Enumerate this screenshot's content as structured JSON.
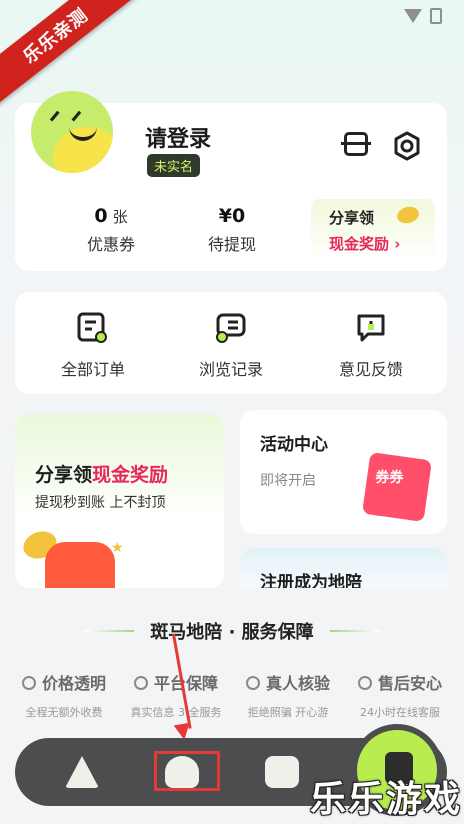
{
  "overlay": {
    "ribbon_text": "乐乐亲测",
    "watermark_text": "乐乐游戏"
  },
  "profile": {
    "login_text": "请登录",
    "verify_badge": "未实名",
    "stats": [
      {
        "num": "0",
        "unit": "张",
        "label": "优惠券"
      },
      {
        "num": "¥0",
        "unit": "",
        "label": "待提现"
      }
    ],
    "share": {
      "line1": "分享领",
      "line2": "现金奖励 ›"
    }
  },
  "orders": [
    {
      "label": "全部订单",
      "icon": "order-list-icon"
    },
    {
      "label": "浏览记录",
      "icon": "history-icon"
    },
    {
      "label": "意见反馈",
      "icon": "feedback-icon"
    }
  ],
  "promo": {
    "share_title_a": "分享领",
    "share_title_b": "现金奖励",
    "share_sub": "提现秒到账 上不封顶",
    "activity_title": "活动中心",
    "activity_sub": "即将开启",
    "coupon_text": "券券",
    "register_title": "注册成为地陪"
  },
  "service": {
    "title": "斑马地陪 · 服务保障",
    "items": [
      {
        "name": "价格透明",
        "desc": "全程无额外收费"
      },
      {
        "name": "平台保障",
        "desc": "真实信息 3 全服务"
      },
      {
        "name": "真人核验",
        "desc": "拒绝照骗 开心游"
      },
      {
        "name": "售后安心",
        "desc": "24小时在线客服"
      }
    ]
  },
  "tabbar": {
    "tabs": [
      "tab-home",
      "tab-discover",
      "tab-message",
      "tab-mine"
    ],
    "active": "tab-mine"
  },
  "colors": {
    "accent_green": "#b9ec4f",
    "accent_pink": "#e6285b",
    "highlight_red": "#e53935"
  }
}
